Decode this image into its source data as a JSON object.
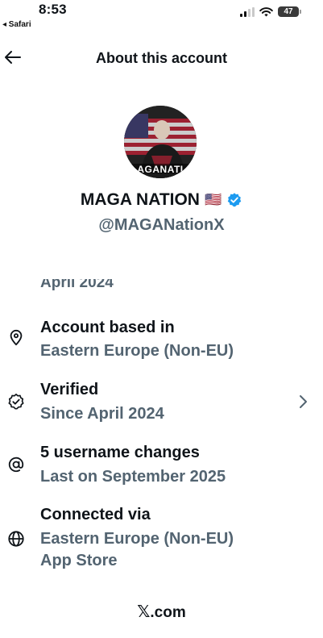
{
  "status_bar": {
    "time": "8:53",
    "back_app": "◂ Safari",
    "battery": "47"
  },
  "header": {
    "title": "About this account"
  },
  "profile": {
    "avatar_text": "AGANATI",
    "display_name": "MAGA NATION",
    "flag": "🇺🇸",
    "handle": "@MAGANationX",
    "verified_color": "#1d9bf0"
  },
  "partial_row": {
    "text": "April 2024"
  },
  "rows": [
    {
      "icon": "location-pin-icon",
      "label": "Account based in",
      "sub": [
        "Eastern Europe (Non-EU)"
      ]
    },
    {
      "icon": "verified-badge-icon",
      "label": "Verified",
      "sub": [
        "Since April 2024"
      ],
      "has_chevron": true
    },
    {
      "icon": "at-sign-icon",
      "label": "5 username changes",
      "sub": [
        "Last on September 2025"
      ]
    },
    {
      "icon": "globe-icon",
      "label": "Connected via",
      "sub": [
        "Eastern Europe (Non-EU)",
        "App Store"
      ]
    }
  ],
  "footer": {
    "x_glyph": "𝕏",
    "text": ".com"
  },
  "colors": {
    "text": "#0f1419",
    "secondary": "#536471"
  }
}
